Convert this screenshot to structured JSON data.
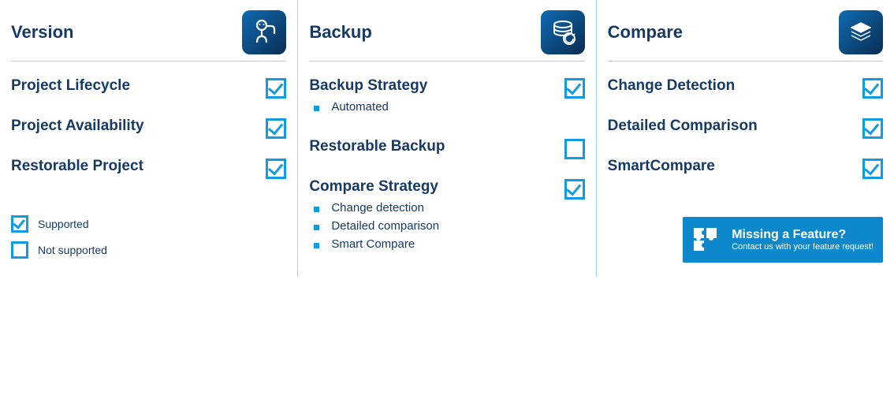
{
  "columns": [
    {
      "title": "Version",
      "icon": "version-icon",
      "rows": [
        {
          "label": "Project Lifecycle",
          "supported": true,
          "sub": []
        },
        {
          "label": "Project Availability",
          "supported": true,
          "sub": []
        },
        {
          "label": "Restorable Project",
          "supported": true,
          "sub": []
        }
      ]
    },
    {
      "title": "Backup",
      "icon": "backup-icon",
      "rows": [
        {
          "label": "Backup Strategy",
          "supported": true,
          "sub": [
            "Automated"
          ]
        },
        {
          "label": "Restorable Backup",
          "supported": false,
          "sub": []
        },
        {
          "label": "Compare Strategy",
          "supported": true,
          "sub": [
            "Change detection",
            "Detailed comparison",
            "Smart Compare"
          ]
        }
      ]
    },
    {
      "title": "Compare",
      "icon": "compare-icon",
      "rows": [
        {
          "label": "Change Detection",
          "supported": true,
          "sub": []
        },
        {
          "label": "Detailed Comparison",
          "supported": true,
          "sub": []
        },
        {
          "label": "SmartCompare",
          "supported": true,
          "sub": []
        }
      ]
    }
  ],
  "legend": {
    "supported": "Supported",
    "not_supported": "Not supported"
  },
  "cta": {
    "title": "Missing a Feature?",
    "sub": "Contact us with your feature request!"
  }
}
